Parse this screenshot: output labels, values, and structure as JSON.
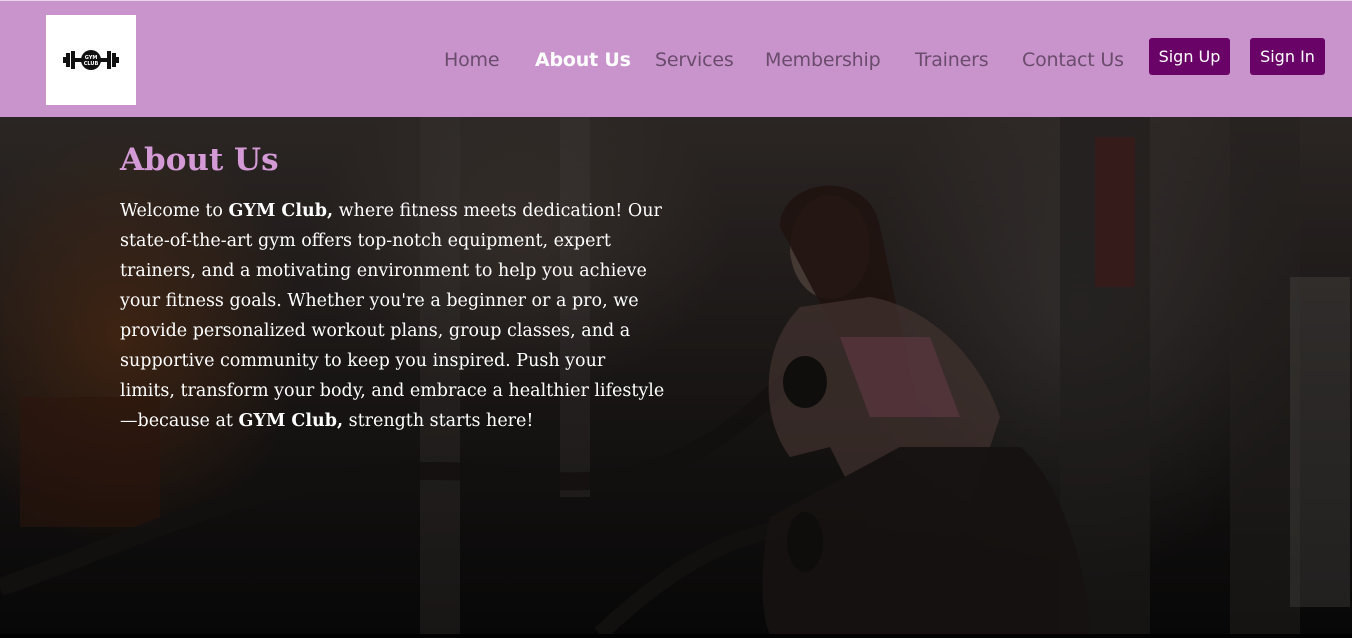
{
  "brand": {
    "logo_text_top": "GYM",
    "logo_text_bottom": "CLUB"
  },
  "nav": {
    "links": [
      {
        "label": "Home",
        "active": false
      },
      {
        "label": "About Us",
        "active": true
      },
      {
        "label": "Services",
        "active": false
      },
      {
        "label": "Membership",
        "active": false
      },
      {
        "label": "Trainers",
        "active": false
      },
      {
        "label": "Contact Us",
        "active": false
      }
    ],
    "sign_up": "Sign Up",
    "sign_in": "Sign In"
  },
  "about": {
    "title": "About Us",
    "p_welcome": "Welcome to ",
    "brand_name": "GYM Club,",
    "p_part1": " where fitness meets dedication! Our state-of-the-art gym offers top-notch equipment, expert trainers, and a motivating environment to help you achieve your fitness goals. Whether you're a beginner or a pro, we provide personalized workout plans, group classes, and a supportive community to keep you inspired. Push your limits, transform your body, and embrace a healthier lifestyle—because at ",
    "p_end": " strength starts here!"
  },
  "colors": {
    "navbar_bg": "#c994cc",
    "button_bg": "#6a0368",
    "title_color": "#d39ad6",
    "link_color": "#6b4c6d"
  }
}
